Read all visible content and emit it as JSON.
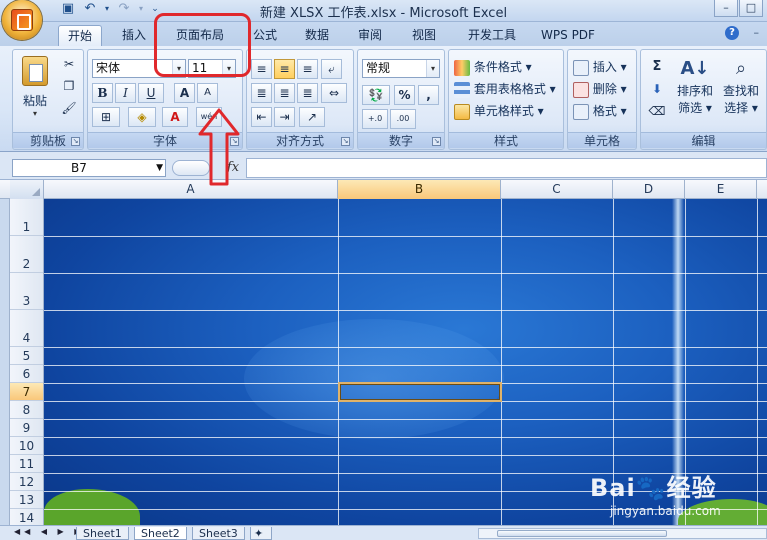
{
  "titlebar": {
    "title": "新建 XLSX 工作表.xlsx - Microsoft Excel",
    "minimize": "–",
    "maximize": "□"
  },
  "tabs": [
    {
      "label": "开始",
      "active": true
    },
    {
      "label": "插入"
    },
    {
      "label": "页面布局"
    },
    {
      "label": "公式"
    },
    {
      "label": "数据"
    },
    {
      "label": "审阅"
    },
    {
      "label": "视图"
    },
    {
      "label": "开发工具"
    },
    {
      "label": "WPS PDF"
    }
  ],
  "ribbon": {
    "clipboard": {
      "label": "剪贴板",
      "paste": "粘贴"
    },
    "font": {
      "label": "字体",
      "font_name": "宋体",
      "font_size": "11",
      "bold": "B",
      "italic": "I",
      "underline": "U",
      "grow": "A",
      "shrink": "A",
      "font_color": "A",
      "phonetic": "wén"
    },
    "alignment": {
      "label": "对齐方式"
    },
    "number": {
      "label": "数字",
      "format": "常规",
      "percent": "%",
      "comma": ","
    },
    "styles": {
      "label": "样式",
      "conditional": "条件格式",
      "table": "套用表格格式",
      "cell_styles": "单元格样式"
    },
    "cells": {
      "label": "单元格",
      "insert": "插入",
      "delete": "删除",
      "format": "格式"
    },
    "editing": {
      "label": "编辑",
      "sum": "Σ",
      "sort_1": "排序和",
      "sort_2": "筛选",
      "find_1": "查找和",
      "find_2": "选择"
    }
  },
  "formula_bar": {
    "name_box": "B7",
    "fx": "fx",
    "value": ""
  },
  "sheet": {
    "columns": [
      "A",
      "B",
      "C",
      "D",
      "E"
    ],
    "rows": [
      "1",
      "2",
      "3",
      "4",
      "5",
      "6",
      "7",
      "8",
      "9",
      "10",
      "11",
      "12",
      "13",
      "14"
    ],
    "selected_cell": "B7",
    "selected_column": "B",
    "selected_row": "7"
  },
  "sheet_tabs": {
    "tabs": [
      "Sheet1",
      "Sheet2",
      "Sheet3"
    ],
    "active": "Sheet2",
    "nav_arrows": "◀◀ ◀ ▶ ▶▶"
  },
  "watermark": {
    "brand": "Bai",
    "brand_suffix": "经验",
    "url": "jingyan.baidu.com"
  },
  "colors": {
    "annotation": "#e0282c",
    "grid_background": "#1c60c0",
    "selection": "#e0b36a"
  }
}
